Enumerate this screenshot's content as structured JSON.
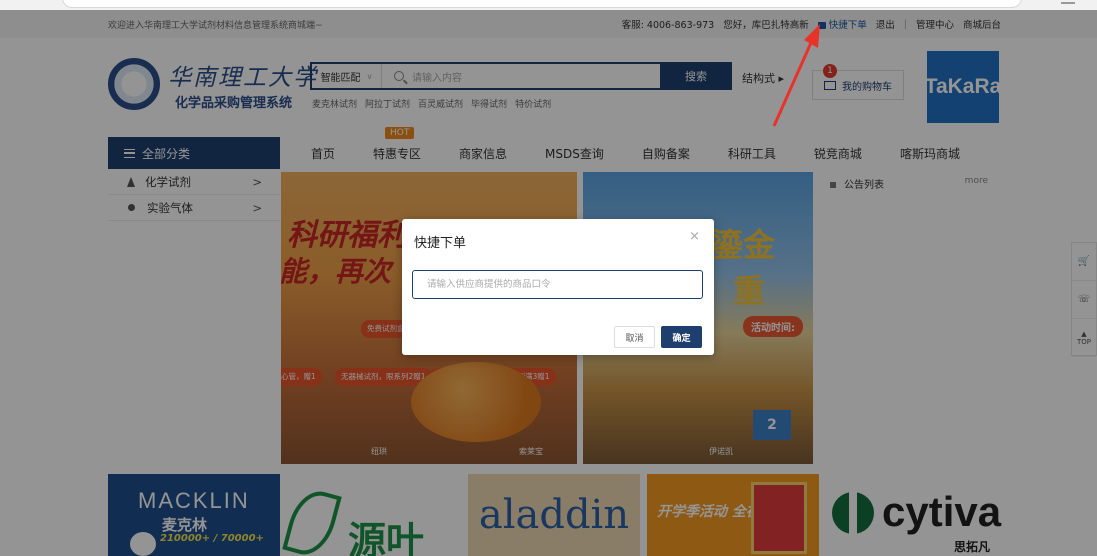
{
  "topbar": {
    "welcome": "欢迎进入华南理工大学试剂材料信息管理系统商城端~",
    "hotline": "客服: 4006-863-973",
    "greeting": "您好，库巴扎特高新",
    "quick_order": "快捷下单",
    "logout": "退出",
    "separator": "|",
    "admin": "管理中心",
    "mall_backend": "商城后台"
  },
  "header": {
    "university_name": "华南理工大学",
    "system_name": "化学品采购管理系统",
    "search_mode": "智能匹配",
    "search_placeholder": "请输入内容",
    "search_button": "搜索",
    "structure_search": "结构式 ▸",
    "hot_words": [
      "麦克林试剂",
      "阿拉丁试剂",
      "百灵威试剂",
      "毕得试剂",
      "特价试剂"
    ],
    "cart_label": "我的购物车",
    "cart_count": "1",
    "brand_logo": "TaKaRa"
  },
  "nav": {
    "all_categories": "全部分类",
    "hot_badge": "HOT",
    "links": [
      "首页",
      "特惠专区",
      "商家信息",
      "MSDS查询",
      "自购备案",
      "科研工具",
      "锐竞商城",
      "喀斯玛商城"
    ]
  },
  "categories": [
    {
      "label": "化学试剂",
      "icon": "flask-icon"
    },
    {
      "label": "实验气体",
      "icon": "gas-icon"
    }
  ],
  "banners": {
    "b1_title": "科研福利",
    "b1_title2": "能，再次",
    "b1_tags": [
      "免费试剂盒，选专属福品",
      "无器械试剂，限系列2赠1",
      "快捷限制性内切酶，全系列满3赠1",
      "心管，赠1"
    ],
    "b1_caps": [
      "纽珙",
      "索莱宝"
    ],
    "b2_title": "鎏金",
    "b2_title2": "重",
    "b2_pill": "活动时间:",
    "b2_gift": "2",
    "b2_cap": "伊诺凯"
  },
  "notice": {
    "title": "公告列表",
    "more": "more"
  },
  "sidetool": {
    "cart": "🛒",
    "phone": "☏",
    "top": "TOP"
  },
  "brands": {
    "macklin": "MACKLIN",
    "macklin_cn": "麦克林",
    "macklin_numbers": "210000+ / 70000+",
    "yuanye": "源叶",
    "aladdin": "aladdin",
    "promo": "开学季活动 全在这里了!",
    "cytiva": "cytiva",
    "cytiva_cn": "思拓凡"
  },
  "modal": {
    "title": "快捷下单",
    "close": "×",
    "input_placeholder": "请输入供应商提供的商品口令",
    "cancel": "取消",
    "confirm": "确定"
  },
  "colors": {
    "primary": "#1e3f6e",
    "accent_red": "#e03b2e",
    "hot_orange": "#f08a1a",
    "overlay": "rgba(0,0,0,0.42)"
  }
}
